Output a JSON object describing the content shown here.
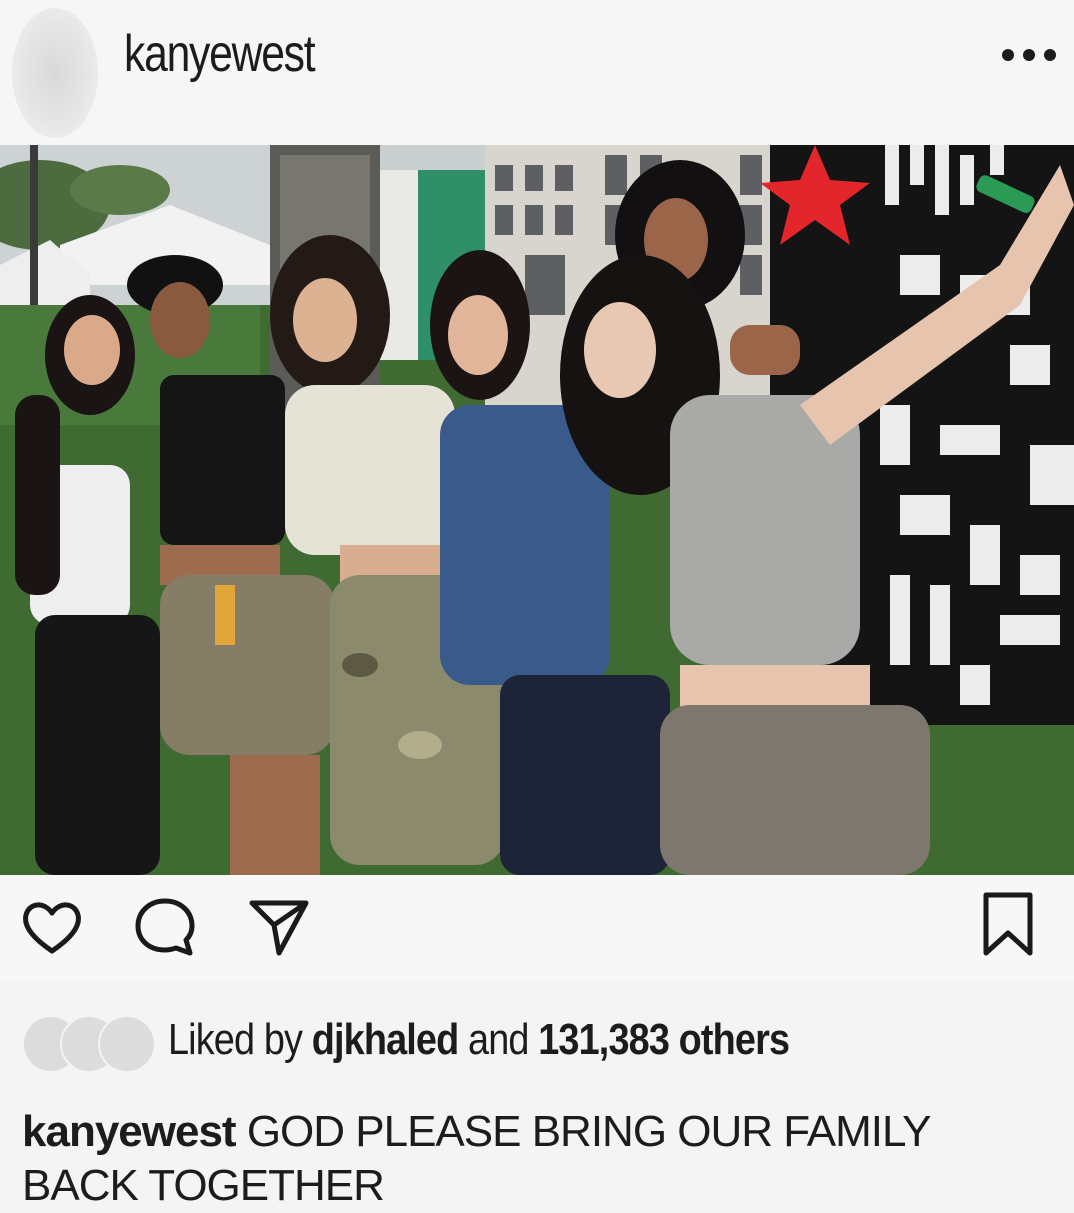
{
  "post": {
    "username": "kanyewest",
    "likes": {
      "prefix": "Liked by",
      "first_user": "djkhaled",
      "joiner": "and",
      "count_text": "131,383 others"
    },
    "caption": {
      "username": "kanyewest",
      "text": "GOD PLEASE BRING OUR FAMILY BACK TOGETHER"
    }
  },
  "photo": {
    "description_colors": {
      "sky": "#c9cfcf",
      "grass": "#3f6b32",
      "backdrop_dark": "#141414",
      "star": "#e3262b",
      "wall": "#d8d5cf"
    }
  },
  "icons": [
    "more-icon",
    "heart-icon",
    "comment-icon",
    "share-icon",
    "bookmark-icon"
  ]
}
